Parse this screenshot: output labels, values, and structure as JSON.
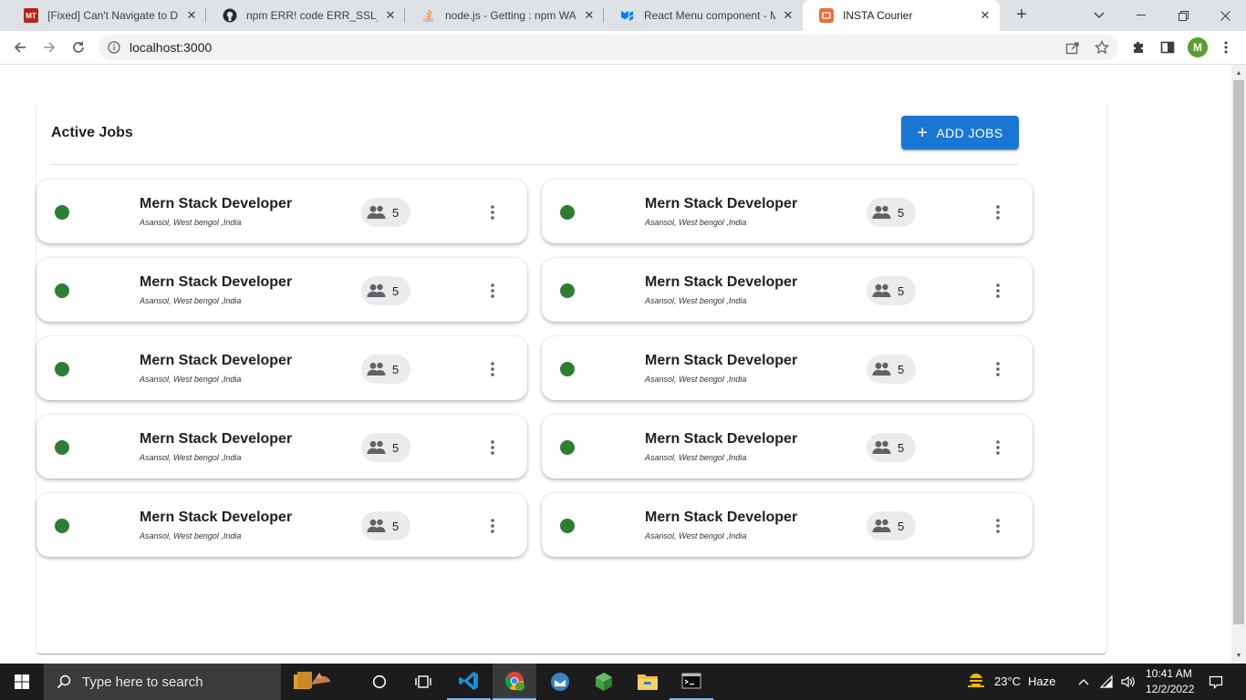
{
  "browser": {
    "tabs": [
      {
        "title": "[Fixed] Can't Navigate to D D",
        "favicon": "MT",
        "active": false
      },
      {
        "title": "npm ERR! code ERR_SSL_CIPH",
        "favicon": "github-icon",
        "active": false
      },
      {
        "title": "node.js - Getting : npm WARI",
        "favicon": "stackoverflow-icon",
        "active": false
      },
      {
        "title": "React Menu component - Ma",
        "favicon": "mui-icon",
        "active": false
      },
      {
        "title": "INSTA Courier",
        "favicon": "react-app-icon",
        "active": true
      }
    ],
    "url": "localhost:3000",
    "profile_initial": "M"
  },
  "page": {
    "title": "Active Jobs",
    "add_button_label": "ADD JOBS",
    "jobs": [
      {
        "title": "Mern Stack Developer",
        "location": "Asansol, West bengol ,India",
        "applicants": "5",
        "status_color": "#2e7d32"
      },
      {
        "title": "Mern Stack Developer",
        "location": "Asansol, West bengol ,India",
        "applicants": "5",
        "status_color": "#2e7d32"
      },
      {
        "title": "Mern Stack Developer",
        "location": "Asansol, West bengol ,India",
        "applicants": "5",
        "status_color": "#2e7d32"
      },
      {
        "title": "Mern Stack Developer",
        "location": "Asansol, West bengol ,India",
        "applicants": "5",
        "status_color": "#2e7d32"
      },
      {
        "title": "Mern Stack Developer",
        "location": "Asansol, West bengol ,India",
        "applicants": "5",
        "status_color": "#2e7d32"
      },
      {
        "title": "Mern Stack Developer",
        "location": "Asansol, West bengol ,India",
        "applicants": "5",
        "status_color": "#2e7d32"
      },
      {
        "title": "Mern Stack Developer",
        "location": "Asansol, West bengol ,India",
        "applicants": "5",
        "status_color": "#2e7d32"
      },
      {
        "title": "Mern Stack Developer",
        "location": "Asansol, West bengol ,India",
        "applicants": "5",
        "status_color": "#2e7d32"
      },
      {
        "title": "Mern Stack Developer",
        "location": "Asansol, West bengol ,India",
        "applicants": "5",
        "status_color": "#2e7d32"
      },
      {
        "title": "Mern Stack Developer",
        "location": "Asansol, West bengol ,India",
        "applicants": "5",
        "status_color": "#2e7d32"
      }
    ]
  },
  "taskbar": {
    "search_placeholder": "Type here to search",
    "weather": "23°C",
    "weather_label": "Haze",
    "time": "10:41 AM",
    "date": "12/2/2022"
  },
  "colors": {
    "primary": "#1976d2",
    "status_active": "#2e7d32"
  }
}
